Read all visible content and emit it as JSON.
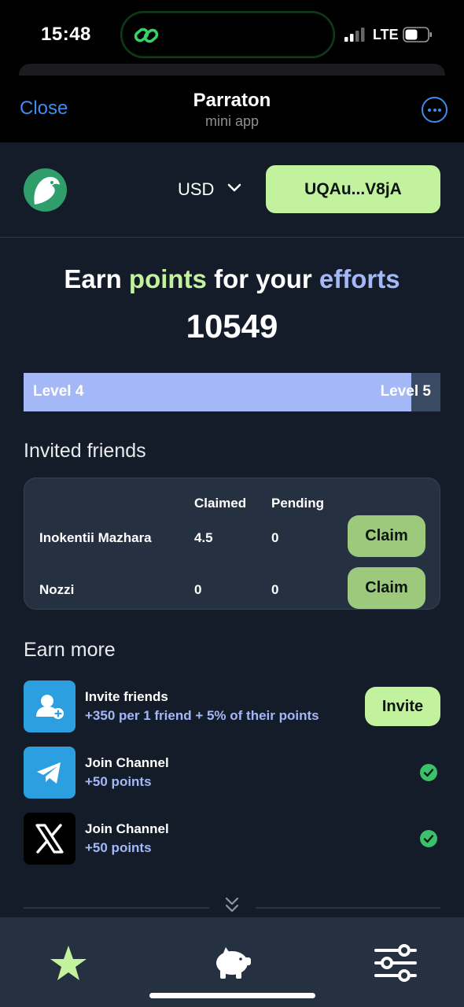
{
  "status_bar": {
    "time": "15:48",
    "network": "LTE"
  },
  "header": {
    "close_label": "Close",
    "title": "Parraton",
    "subtitle": "mini app"
  },
  "top_bar": {
    "currency": "USD",
    "wallet_address": "UQAu...V8jA"
  },
  "hero": {
    "headline_parts": [
      "Earn ",
      "points",
      " for your ",
      "efforts"
    ],
    "points": "10549",
    "level_current": "Level 4",
    "level_next": "Level 5",
    "level_progress": 0.93
  },
  "invited": {
    "title": "Invited friends",
    "columns": [
      "Claimed",
      "Pending"
    ],
    "rows": [
      {
        "name": "Inokentii Mazhara",
        "claimed": "4.5",
        "pending": "0",
        "action": "Claim"
      },
      {
        "name": "Nozzi",
        "claimed": "0",
        "pending": "0",
        "action": "Claim"
      }
    ]
  },
  "earn_more": {
    "title": "Earn more",
    "tasks": [
      {
        "icon": "invite-friend-icon",
        "title": "Invite friends",
        "subtitle": "+350 per 1 friend + 5% of their points",
        "action": "Invite"
      },
      {
        "icon": "telegram-icon",
        "title": "Join Channel",
        "subtitle": "+50 points",
        "status": "completed"
      },
      {
        "icon": "x-logo-icon",
        "title": "Join Channel",
        "subtitle": "+50 points",
        "status": "completed"
      }
    ]
  },
  "bottom_nav": {
    "items": [
      "star-icon",
      "piggy-bank-icon",
      "sliders-icon"
    ]
  },
  "colors": {
    "accent_green": "#c3f29f",
    "accent_blue": "#a4b7f6",
    "background": "#141c29",
    "card": "#253140",
    "link_blue": "#3e8cf0"
  }
}
